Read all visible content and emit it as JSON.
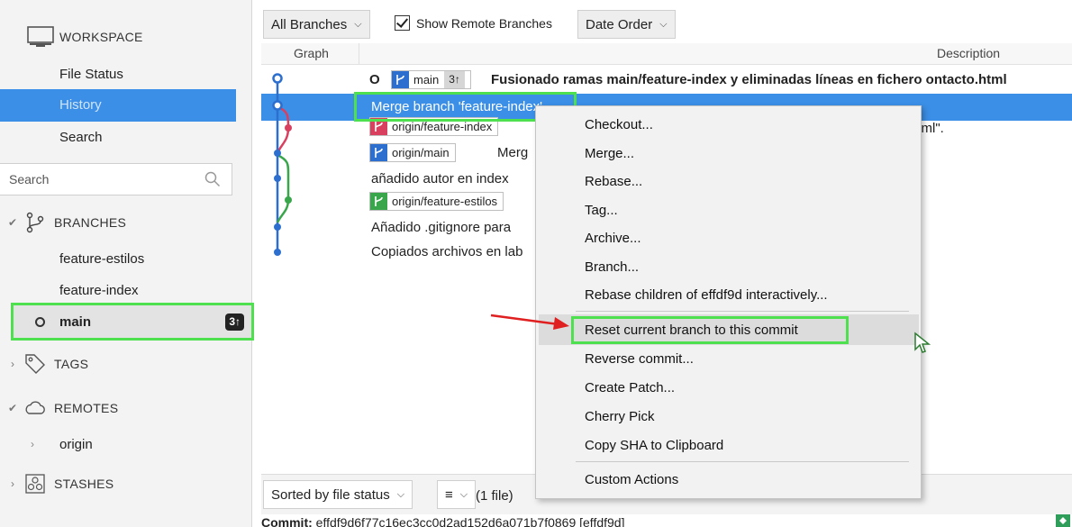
{
  "sidebar": {
    "workspace_title": "WORKSPACE",
    "nav": [
      {
        "label": "File Status"
      },
      {
        "label": "History"
      },
      {
        "label": "Search"
      }
    ],
    "search_placeholder": "Search",
    "branches_title": "BRANCHES",
    "branches": [
      {
        "label": "feature-estilos"
      },
      {
        "label": "feature-index"
      },
      {
        "label": "main",
        "badge": "3↑"
      }
    ],
    "tags_title": "TAGS",
    "remotes_title": "REMOTES",
    "remotes": [
      {
        "label": "origin"
      }
    ],
    "stashes_title": "STASHES"
  },
  "toolbar": {
    "branches_dropdown": "All Branches",
    "show_remote_label": "Show Remote Branches",
    "order_dropdown": "Date Order"
  },
  "columns": {
    "graph": "Graph",
    "description": "Description"
  },
  "commits": [
    {
      "ref": "main",
      "ahead": "3↑",
      "message": "Fusionado ramas main/feature-index y eliminadas líneas en fichero ontacto.html"
    },
    {
      "message": "Merge branch 'feature-index'"
    },
    {
      "ref": "origin/feature-index",
      "message_tail": "html\"."
    },
    {
      "ref": "origin/main",
      "message": "Merg"
    },
    {
      "message": "añadido autor en index"
    },
    {
      "ref": "origin/feature-estilos"
    },
    {
      "message": "Añadido .gitignore para"
    },
    {
      "message": "Copiados archivos en lab"
    }
  ],
  "bottom": {
    "sort_dropdown": "Sorted by file status",
    "list_icon": "≡",
    "files_count": "(1 file)",
    "commit_label": "Commit:",
    "commit_sha": "effdf9d6f77c16ec3cc0d2ad152d6a071b7f0869 [effdf9d]"
  },
  "context_menu": {
    "items": [
      "Checkout...",
      "Merge...",
      "Rebase...",
      "Tag...",
      "Archive...",
      "Branch...",
      "Rebase children of effdf9d interactively...",
      "Reset current branch to this commit",
      "Reverse commit...",
      "Create Patch...",
      "Cherry Pick",
      "Copy SHA to Clipboard",
      "Custom Actions"
    ]
  },
  "colors": {
    "selection": "#3b8fe6",
    "highlight_box": "#4fe04f",
    "graph_blue": "#2d6fcf",
    "graph_red": "#d9405f",
    "graph_green": "#3aa64b",
    "annotation_arrow": "#e02020"
  }
}
